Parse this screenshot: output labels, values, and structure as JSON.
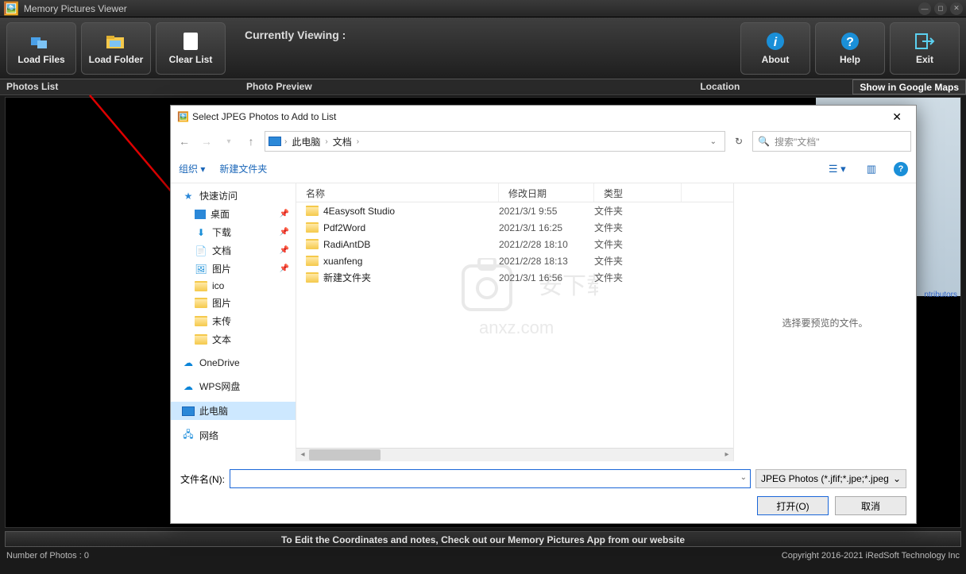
{
  "app": {
    "title": "Memory Pictures Viewer",
    "toolbar": {
      "load_files": "Load Files",
      "load_folder": "Load Folder",
      "clear_list": "Clear List",
      "about": "About",
      "help": "Help",
      "exit": "Exit"
    },
    "currently_viewing_label": "Currently Viewing :",
    "sections": {
      "photos_list": "Photos List",
      "photo_preview": "Photo Preview",
      "location": "Location",
      "show_in_maps": "Show in Google Maps"
    },
    "map_attrib": "ntributors",
    "footer_message": "To Edit the Coordinates and notes, Check out our Memory Pictures App from our website",
    "status_left": "Number of Photos : 0",
    "status_right": "Copyright 2016-2021 iRedSoft Technology Inc"
  },
  "dialog": {
    "title": "Select JPEG Photos to Add to List",
    "breadcrumb": [
      "此电脑",
      "文档"
    ],
    "search_placeholder": "搜索\"文档\"",
    "toolbar": {
      "organize": "组织",
      "new_folder": "新建文件夹"
    },
    "columns": {
      "name": "名称",
      "date": "修改日期",
      "type": "类型"
    },
    "tree": {
      "quick_access": "快速访问",
      "items": [
        {
          "label": "桌面",
          "pinned": true,
          "icon": "desktop"
        },
        {
          "label": "下载",
          "pinned": true,
          "icon": "download"
        },
        {
          "label": "文档",
          "pinned": true,
          "icon": "document"
        },
        {
          "label": "图片",
          "pinned": true,
          "icon": "picture"
        },
        {
          "label": "ico",
          "pinned": false,
          "icon": "folder"
        },
        {
          "label": "图片",
          "pinned": false,
          "icon": "folder"
        },
        {
          "label": "末传",
          "pinned": false,
          "icon": "folder"
        },
        {
          "label": "文本",
          "pinned": false,
          "icon": "folder"
        }
      ],
      "onedrive": "OneDrive",
      "wps": "WPS网盘",
      "this_pc": "此电脑",
      "network": "网络"
    },
    "files": [
      {
        "name": "4Easysoft Studio",
        "date": "2021/3/1 9:55",
        "type": "文件夹"
      },
      {
        "name": "Pdf2Word",
        "date": "2021/3/1 16:25",
        "type": "文件夹"
      },
      {
        "name": "RadiAntDB",
        "date": "2021/2/28 18:10",
        "type": "文件夹"
      },
      {
        "name": "xuanfeng",
        "date": "2021/2/28 18:13",
        "type": "文件夹"
      },
      {
        "name": "新建文件夹",
        "date": "2021/3/1 16:56",
        "type": "文件夹"
      }
    ],
    "preview_placeholder": "选择要预览的文件。",
    "watermark": "anxz.com",
    "filename_label": "文件名(N):",
    "filename_value": "",
    "filter": "JPEG Photos (*.jfif;*.jpe;*.jpeg",
    "open_btn": "打开(O)",
    "cancel_btn": "取消"
  }
}
